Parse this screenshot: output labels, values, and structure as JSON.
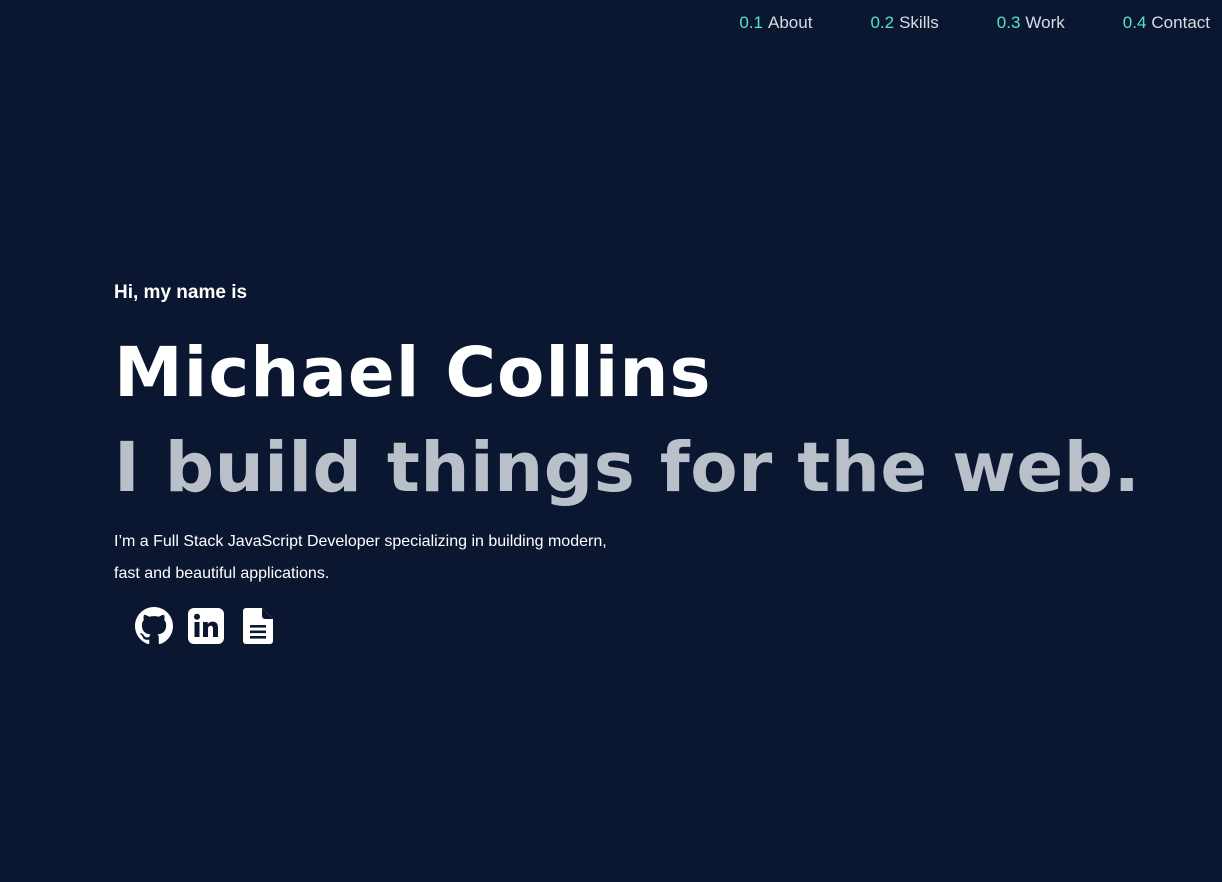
{
  "nav": {
    "items": [
      {
        "number": "0.1",
        "label": "About"
      },
      {
        "number": "0.2",
        "label": "Skills"
      },
      {
        "number": "0.3",
        "label": "Work"
      },
      {
        "number": "0.4",
        "label": "Contact"
      }
    ]
  },
  "hero": {
    "intro": "Hi, my name is",
    "name": "Michael Collins",
    "tagline": "I build things for the web.",
    "description": "I’m a Full Stack JavaScript Developer specializing in building modern, fast and beautiful applications."
  },
  "social": [
    {
      "icon": "github-icon"
    },
    {
      "icon": "linkedin-icon"
    },
    {
      "icon": "document-icon"
    }
  ],
  "colors": {
    "background": "#0b1730",
    "accent": "#58e3c5",
    "text": "#ffffff",
    "muted": "#b9c0ca"
  }
}
